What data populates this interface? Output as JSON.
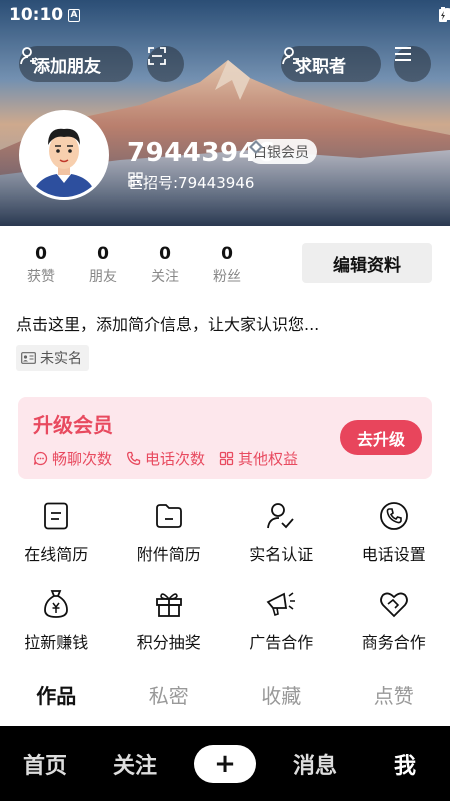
{
  "status": {
    "time": "10:10",
    "notif": "A"
  },
  "header": {
    "add_friend": "添加朋友",
    "job_seeker": "求职者"
  },
  "profile": {
    "user_id": "79443946",
    "member_badge": "白银会员",
    "juzhao_label": "巨招号:79443946",
    "bio": "点击这里，添加简介信息，让大家认识您...",
    "verify_tag": "未实名"
  },
  "stats": [
    {
      "num": "0",
      "label": "获赞"
    },
    {
      "num": "0",
      "label": "朋友"
    },
    {
      "num": "0",
      "label": "关注"
    },
    {
      "num": "0",
      "label": "粉丝"
    }
  ],
  "edit_profile": "编辑资料",
  "vip": {
    "title": "升级会员",
    "perks": [
      "畅聊次数",
      "电话次数",
      "其他权益"
    ],
    "button": "去升级",
    "accent": "#e84a5f"
  },
  "grid": [
    {
      "label": "在线简历",
      "icon": "resume-icon"
    },
    {
      "label": "附件简历",
      "icon": "folder-icon"
    },
    {
      "label": "实名认证",
      "icon": "user-check-icon"
    },
    {
      "label": "电话设置",
      "icon": "phone-icon"
    },
    {
      "label": "拉新赚钱",
      "icon": "money-bag-icon"
    },
    {
      "label": "积分抽奖",
      "icon": "gift-icon"
    },
    {
      "label": "广告合作",
      "icon": "megaphone-icon"
    },
    {
      "label": "商务合作",
      "icon": "handshake-icon"
    }
  ],
  "tabs": [
    "作品",
    "私密",
    "收藏",
    "点赞"
  ],
  "nav": {
    "home": "首页",
    "follow": "关注",
    "plus": "+",
    "messages": "消息",
    "me": "我"
  }
}
